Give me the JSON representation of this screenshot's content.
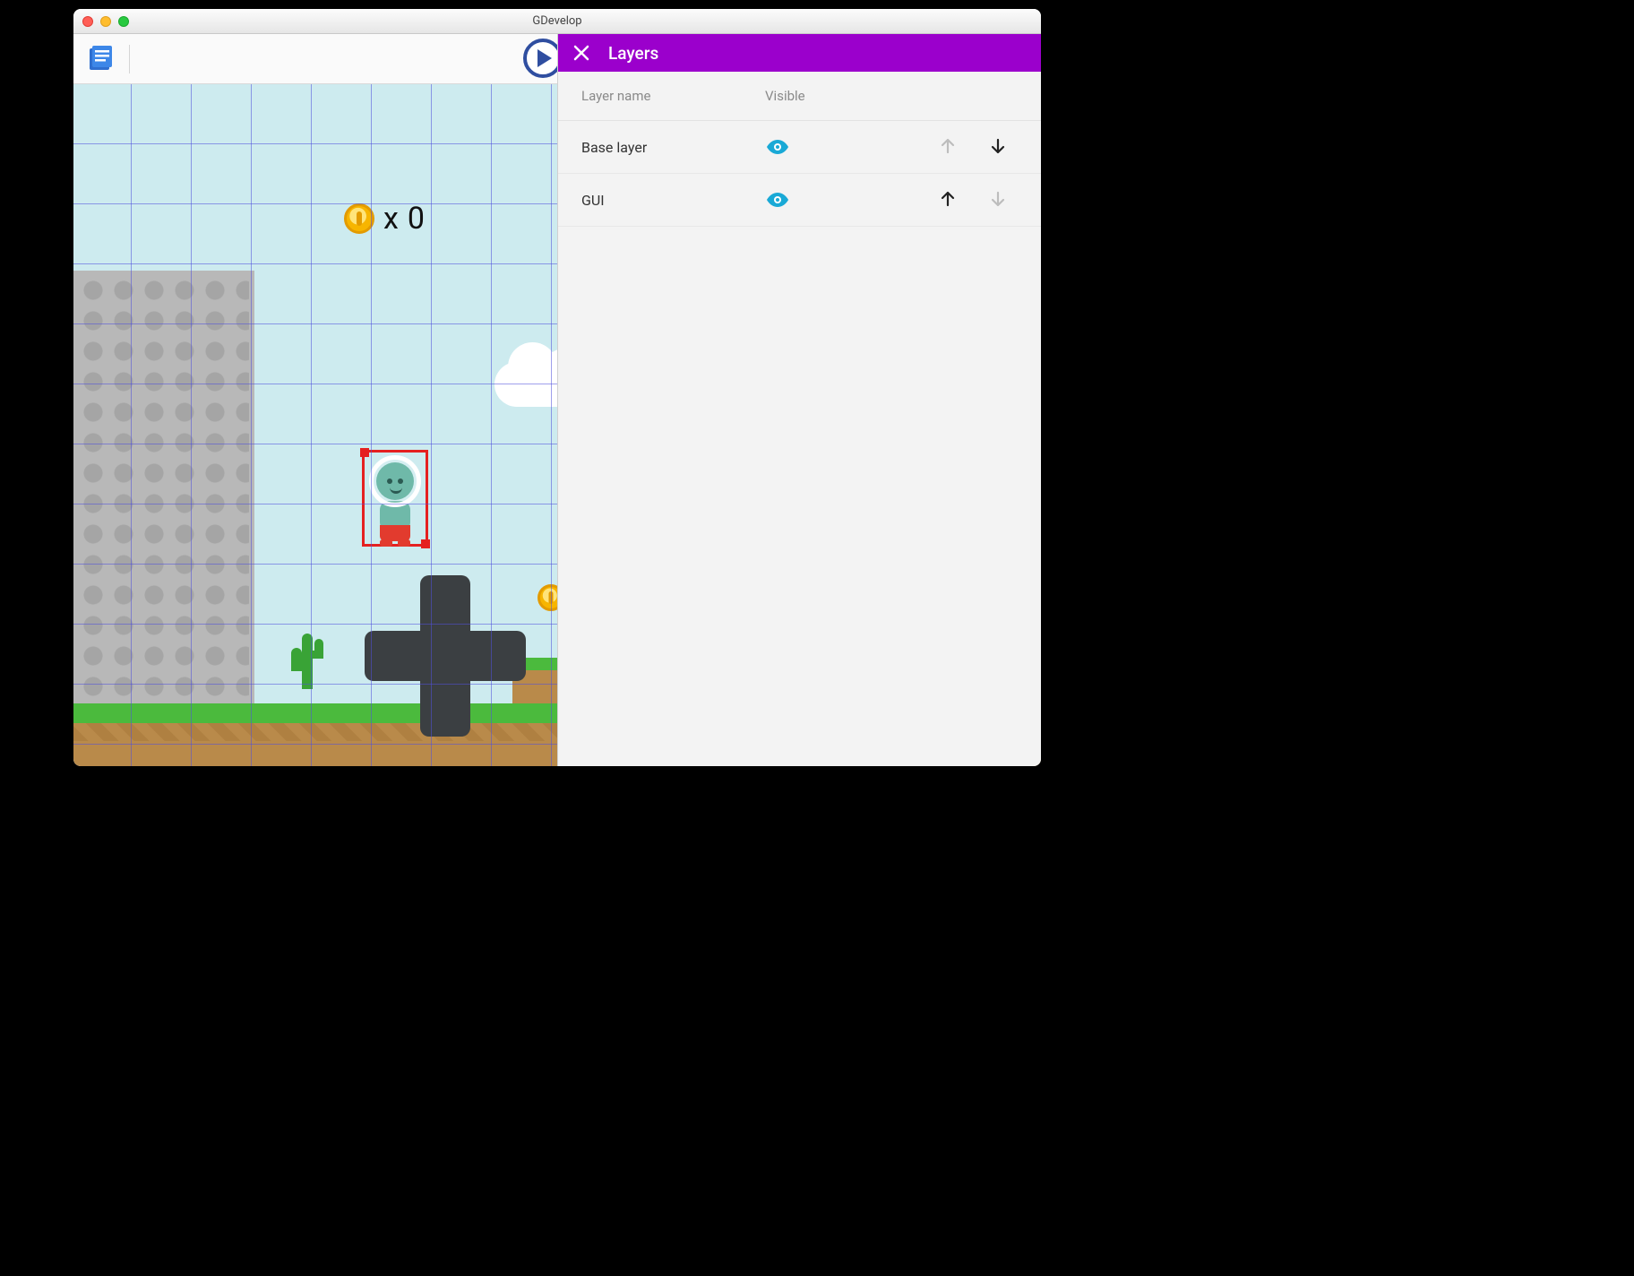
{
  "window": {
    "title": "GDevelop"
  },
  "panel": {
    "title": "Layers",
    "columns": {
      "name": "Layer name",
      "visible": "Visible"
    },
    "rows": [
      {
        "name": "Base layer",
        "visible": true,
        "up_enabled": false,
        "down_enabled": true
      },
      {
        "name": "GUI",
        "visible": true,
        "up_enabled": true,
        "down_enabled": false
      }
    ]
  },
  "hud": {
    "coin_prefix": "x",
    "coin_count": "0"
  }
}
